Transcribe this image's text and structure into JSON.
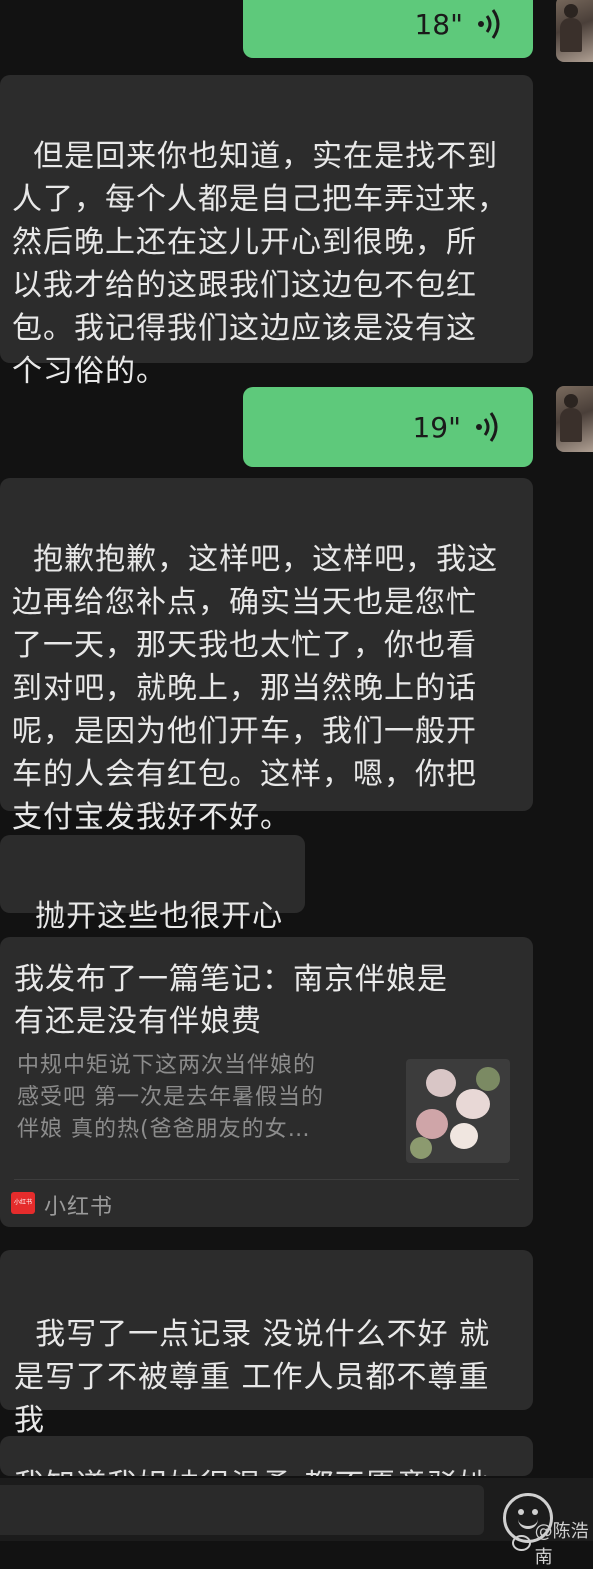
{
  "messages": [
    {
      "type": "voice",
      "side": "right",
      "duration": "18\""
    },
    {
      "type": "text",
      "side": "left",
      "text": "但是回来你也知道，实在是找不到\n人了，每个人都是自己把车弄过来，\n然后晚上还在这儿开心到很晚，所\n以我才给的这跟我们这边包不包红\n包。我记得我们这边应该是没有这\n个习俗的。"
    },
    {
      "type": "voice",
      "side": "right",
      "duration": "19\""
    },
    {
      "type": "text",
      "side": "left",
      "text": "抱歉抱歉，这样吧，这样吧，我这\n边再给您补点，确实当天也是您忙\n了一天，那天我也太忙了，你也看\n到对吧，就晚上，那当然晚上的话\n呢，是因为他们开车，我们一般开\n车的人会有红包。这样，嗯，你把\n支付宝发我好不好。"
    },
    {
      "type": "text",
      "side": "left",
      "text": "抛开这些也很开心"
    },
    {
      "type": "card",
      "side": "left",
      "title": "我发布了一篇笔记：南京伴娘是\n有还是没有伴娘费",
      "description": "中规中矩说下这两次当伴娘的\n感受吧 第一次是去年暑假当的\n伴娘 真的热(爸爸朋友的女…",
      "source_logo_text": "小红书",
      "source": "小红书"
    },
    {
      "type": "text",
      "side": "left",
      "text": "我写了一点记录 没说什么不好 就\n是写了不被尊重 工作人员都不尊重\n我"
    },
    {
      "type": "text",
      "side": "left",
      "text": "我知道我姐妹很温柔 都不愿意驳她"
    }
  ],
  "input_bar": {
    "placeholder": ""
  },
  "watermark": "@陈浩南",
  "colors": {
    "background": "#121212",
    "left_bubble": "#2c2c2c",
    "right_bubble": "#5ec97b"
  }
}
